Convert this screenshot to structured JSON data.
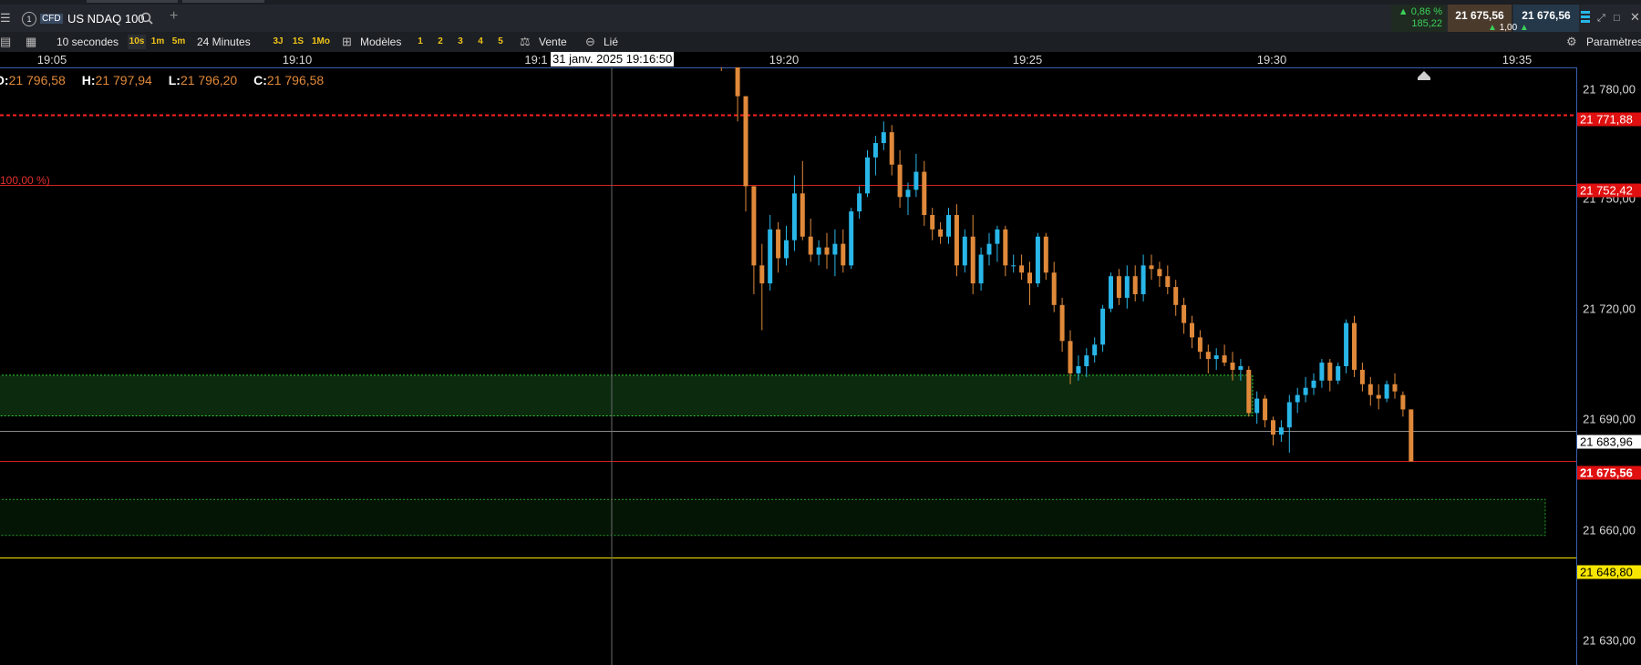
{
  "header": {
    "tab_number": "1",
    "cfd_badge": "CFD",
    "instrument": "US NDAQ 100",
    "add_tab_icon": "plus-icon",
    "change_pct": "0,86 %",
    "change_abs": "185,22",
    "bid": "21 675,56",
    "ask": "21 676,56",
    "spread": "1,00",
    "up_color": "#3bd15a"
  },
  "toolbar": {
    "interval": "10 secondes",
    "intervals": [
      "10s",
      "1m",
      "5m"
    ],
    "range": "24 Minutes",
    "periods": [
      "3J",
      "1S",
      "1Mo"
    ],
    "templates": "Modèles",
    "layouts": [
      "1",
      "2",
      "3",
      "4",
      "5"
    ],
    "sell": "Vente",
    "linked": "Lié",
    "settings": "Paramètres"
  },
  "crosshair": {
    "date_label": "31 janv. 2025 19:16:50",
    "time_under": "19:1",
    "price_label": "21 683,96"
  },
  "ohlc": {
    "open_label": "O:",
    "open": "21 796,58",
    "high_label": "H:",
    "high": "21 797,94",
    "low_label": "L:",
    "low": "21 796,20",
    "close_label": "C:",
    "close": "21 796,58"
  },
  "annotations": {
    "fib_pct": "100,00 %)"
  },
  "price_tags": {
    "red_dashed": "21 771,88",
    "red_line": "21 752,42",
    "current": "21 675,56",
    "yellow": "21 648,80"
  },
  "chart_data": {
    "type": "candlestick",
    "x_ticks": [
      "19:05",
      "19:10",
      "19:20",
      "19:25",
      "19:30",
      "19:35"
    ],
    "y_ticks": [
      "21 780,00",
      "21 750,00",
      "21 720,00",
      "21 690,00",
      "21 660,00",
      "21 630,00"
    ],
    "ylim": [
      21619,
      21785
    ],
    "colors": {
      "up": "#29b6e8",
      "down": "#e0893a",
      "bg": "#000000"
    },
    "levels": [
      {
        "price": 21771.88,
        "style": "dashed",
        "color": "#ff2020"
      },
      {
        "price": 21752.42,
        "style": "solid",
        "color": "#d42020"
      },
      {
        "price": 21683.96,
        "style": "solid",
        "color": "#8a8a8a"
      },
      {
        "price": 21675.56,
        "style": "solid",
        "color": "#d42020"
      },
      {
        "price": 21648.8,
        "style": "solid",
        "color": "#f7e600"
      }
    ],
    "zones": [
      {
        "top": 21699.5,
        "bottom": 21688.2,
        "color": "#32d032"
      },
      {
        "top": 21665.0,
        "bottom": 21655.0,
        "color": "#2aa02a"
      }
    ],
    "candles": [
      {
        "t": "19:18:40",
        "o": 21786,
        "h": 21786,
        "l": 21784,
        "c": 21785
      },
      {
        "t": "19:18:50",
        "o": 21786,
        "h": 21787,
        "l": 21785,
        "c": 21785
      },
      {
        "t": "19:19:00",
        "o": 21785,
        "h": 21786,
        "l": 21770,
        "c": 21777
      },
      {
        "t": "19:19:10",
        "o": 21777,
        "h": 21777,
        "l": 21745,
        "c": 21752
      },
      {
        "t": "19:19:20",
        "o": 21752,
        "h": 21752,
        "l": 21722,
        "c": 21730
      },
      {
        "t": "19:19:30",
        "o": 21730,
        "h": 21736,
        "l": 21712,
        "c": 21725
      },
      {
        "t": "19:19:40",
        "o": 21725,
        "h": 21744,
        "l": 21723,
        "c": 21740
      },
      {
        "t": "19:19:50",
        "o": 21740,
        "h": 21742,
        "l": 21728,
        "c": 21732
      },
      {
        "t": "19:20:00",
        "o": 21732,
        "h": 21741,
        "l": 21730,
        "c": 21737
      },
      {
        "t": "19:20:10",
        "o": 21737,
        "h": 21755,
        "l": 21734,
        "c": 21750
      },
      {
        "t": "19:20:20",
        "o": 21750,
        "h": 21759,
        "l": 21737,
        "c": 21738
      },
      {
        "t": "19:20:30",
        "o": 21738,
        "h": 21743,
        "l": 21731,
        "c": 21733
      },
      {
        "t": "19:20:40",
        "o": 21733,
        "h": 21737,
        "l": 21730,
        "c": 21735
      },
      {
        "t": "19:20:50",
        "o": 21735,
        "h": 21739,
        "l": 21729,
        "c": 21733
      },
      {
        "t": "19:21:00",
        "o": 21733,
        "h": 21740,
        "l": 21727,
        "c": 21736
      },
      {
        "t": "19:21:10",
        "o": 21736,
        "h": 21740,
        "l": 21728,
        "c": 21730
      },
      {
        "t": "19:21:20",
        "o": 21730,
        "h": 21746,
        "l": 21729,
        "c": 21745
      },
      {
        "t": "19:21:30",
        "o": 21745,
        "h": 21752,
        "l": 21743,
        "c": 21750
      },
      {
        "t": "19:21:40",
        "o": 21750,
        "h": 21762,
        "l": 21749,
        "c": 21760
      },
      {
        "t": "19:21:50",
        "o": 21760,
        "h": 21766,
        "l": 21755,
        "c": 21764
      },
      {
        "t": "19:22:00",
        "o": 21764,
        "h": 21770,
        "l": 21762,
        "c": 21767
      },
      {
        "t": "19:22:10",
        "o": 21767,
        "h": 21769,
        "l": 21755,
        "c": 21758
      },
      {
        "t": "19:22:20",
        "o": 21758,
        "h": 21762,
        "l": 21746,
        "c": 21749
      },
      {
        "t": "19:22:30",
        "o": 21749,
        "h": 21753,
        "l": 21744,
        "c": 21751
      },
      {
        "t": "19:22:40",
        "o": 21751,
        "h": 21761,
        "l": 21749,
        "c": 21756
      },
      {
        "t": "19:22:50",
        "o": 21756,
        "h": 21759,
        "l": 21741,
        "c": 21744
      },
      {
        "t": "19:23:00",
        "o": 21744,
        "h": 21746,
        "l": 21737,
        "c": 21740
      },
      {
        "t": "19:23:10",
        "o": 21740,
        "h": 21742,
        "l": 21736,
        "c": 21738
      },
      {
        "t": "19:23:20",
        "o": 21738,
        "h": 21746,
        "l": 21736,
        "c": 21744
      },
      {
        "t": "19:23:30",
        "o": 21744,
        "h": 21747,
        "l": 21727,
        "c": 21730
      },
      {
        "t": "19:23:40",
        "o": 21730,
        "h": 21740,
        "l": 21728,
        "c": 21738
      },
      {
        "t": "19:23:50",
        "o": 21738,
        "h": 21744,
        "l": 21722,
        "c": 21725
      },
      {
        "t": "19:24:00",
        "o": 21725,
        "h": 21735,
        "l": 21723,
        "c": 21733
      },
      {
        "t": "19:24:10",
        "o": 21733,
        "h": 21739,
        "l": 21730,
        "c": 21736
      },
      {
        "t": "19:24:20",
        "o": 21736,
        "h": 21741,
        "l": 21731,
        "c": 21740
      },
      {
        "t": "19:24:30",
        "o": 21740,
        "h": 21741,
        "l": 21727,
        "c": 21730
      },
      {
        "t": "19:24:40",
        "o": 21730,
        "h": 21733,
        "l": 21728,
        "c": 21730
      },
      {
        "t": "19:24:50",
        "o": 21730,
        "h": 21733,
        "l": 21726,
        "c": 21728
      },
      {
        "t": "19:25:00",
        "o": 21728,
        "h": 21731,
        "l": 21719,
        "c": 21725
      },
      {
        "t": "19:25:10",
        "o": 21725,
        "h": 21739,
        "l": 21724,
        "c": 21738
      },
      {
        "t": "19:25:20",
        "o": 21738,
        "h": 21739,
        "l": 21726,
        "c": 21728
      },
      {
        "t": "19:25:30",
        "o": 21728,
        "h": 21731,
        "l": 21717,
        "c": 21719
      },
      {
        "t": "19:25:40",
        "o": 21719,
        "h": 21721,
        "l": 21706,
        "c": 21709
      },
      {
        "t": "19:25:50",
        "o": 21709,
        "h": 21712,
        "l": 21697,
        "c": 21700
      },
      {
        "t": "19:26:00",
        "o": 21700,
        "h": 21705,
        "l": 21698,
        "c": 21702
      },
      {
        "t": "19:26:10",
        "o": 21702,
        "h": 21707,
        "l": 21699,
        "c": 21705
      },
      {
        "t": "19:26:20",
        "o": 21705,
        "h": 21710,
        "l": 21703,
        "c": 21708
      },
      {
        "t": "19:26:30",
        "o": 21708,
        "h": 21719,
        "l": 21706,
        "c": 21718
      },
      {
        "t": "19:26:40",
        "o": 21718,
        "h": 21728,
        "l": 21717,
        "c": 21727
      },
      {
        "t": "19:26:50",
        "o": 21727,
        "h": 21729,
        "l": 21719,
        "c": 21721
      },
      {
        "t": "19:27:00",
        "o": 21721,
        "h": 21730,
        "l": 21718,
        "c": 21727
      },
      {
        "t": "19:27:10",
        "o": 21727,
        "h": 21730,
        "l": 21720,
        "c": 21722
      },
      {
        "t": "19:27:20",
        "o": 21722,
        "h": 21733,
        "l": 21720,
        "c": 21730
      },
      {
        "t": "19:27:30",
        "o": 21730,
        "h": 21733,
        "l": 21726,
        "c": 21729
      },
      {
        "t": "19:27:40",
        "o": 21729,
        "h": 21731,
        "l": 21724,
        "c": 21727
      },
      {
        "t": "19:27:50",
        "o": 21727,
        "h": 21730,
        "l": 21722,
        "c": 21724
      },
      {
        "t": "19:28:00",
        "o": 21724,
        "h": 21726,
        "l": 21716,
        "c": 21719
      },
      {
        "t": "19:28:10",
        "o": 21719,
        "h": 21721,
        "l": 21711,
        "c": 21714
      },
      {
        "t": "19:28:20",
        "o": 21714,
        "h": 21716,
        "l": 21707,
        "c": 21710
      },
      {
        "t": "19:28:30",
        "o": 21710,
        "h": 21712,
        "l": 21704,
        "c": 21706
      },
      {
        "t": "19:28:40",
        "o": 21706,
        "h": 21708,
        "l": 21700,
        "c": 21704
      },
      {
        "t": "19:28:50",
        "o": 21704,
        "h": 21707,
        "l": 21701,
        "c": 21705
      },
      {
        "t": "19:29:00",
        "o": 21705,
        "h": 21708,
        "l": 21702,
        "c": 21703
      },
      {
        "t": "19:29:10",
        "o": 21703,
        "h": 21706,
        "l": 21698,
        "c": 21701
      },
      {
        "t": "19:29:20",
        "o": 21701,
        "h": 21704,
        "l": 21698,
        "c": 21702
      },
      {
        "t": "19:29:30",
        "o": 21701,
        "h": 21702,
        "l": 21688,
        "c": 21689
      },
      {
        "t": "19:29:40",
        "o": 21689,
        "h": 21695,
        "l": 21686,
        "c": 21693
      },
      {
        "t": "19:29:50",
        "o": 21693,
        "h": 21694,
        "l": 21685,
        "c": 21687
      },
      {
        "t": "19:30:00",
        "o": 21687,
        "h": 21688,
        "l": 21680,
        "c": 21683
      },
      {
        "t": "19:30:10",
        "o": 21683,
        "h": 21687,
        "l": 21681,
        "c": 21685
      },
      {
        "t": "19:30:20",
        "o": 21685,
        "h": 21694,
        "l": 21678,
        "c": 21692
      },
      {
        "t": "19:30:30",
        "o": 21692,
        "h": 21696,
        "l": 21689,
        "c": 21694
      },
      {
        "t": "19:30:40",
        "o": 21694,
        "h": 21699,
        "l": 21692,
        "c": 21696
      },
      {
        "t": "19:30:50",
        "o": 21696,
        "h": 21700,
        "l": 21694,
        "c": 21698
      },
      {
        "t": "19:31:00",
        "o": 21698,
        "h": 21704,
        "l": 21696,
        "c": 21703
      },
      {
        "t": "19:31:10",
        "o": 21703,
        "h": 21704,
        "l": 21695,
        "c": 21698
      },
      {
        "t": "19:31:20",
        "o": 21698,
        "h": 21703,
        "l": 21697,
        "c": 21702
      },
      {
        "t": "19:31:30",
        "o": 21702,
        "h": 21715,
        "l": 21700,
        "c": 21714
      },
      {
        "t": "19:31:40",
        "o": 21714,
        "h": 21716,
        "l": 21699,
        "c": 21701
      },
      {
        "t": "19:31:50",
        "o": 21701,
        "h": 21703,
        "l": 21695,
        "c": 21697
      },
      {
        "t": "19:32:00",
        "o": 21697,
        "h": 21699,
        "l": 21691,
        "c": 21694
      },
      {
        "t": "19:32:10",
        "o": 21694,
        "h": 21697,
        "l": 21690,
        "c": 21693
      },
      {
        "t": "19:32:20",
        "o": 21693,
        "h": 21698,
        "l": 21692,
        "c": 21697
      },
      {
        "t": "19:32:30",
        "o": 21697,
        "h": 21700,
        "l": 21693,
        "c": 21695
      },
      {
        "t": "19:32:40",
        "o": 21694,
        "h": 21695,
        "l": 21688,
        "c": 21690
      },
      {
        "t": "19:32:50",
        "o": 21690,
        "h": 21690,
        "l": 21675.5,
        "c": 21675.56
      }
    ]
  }
}
